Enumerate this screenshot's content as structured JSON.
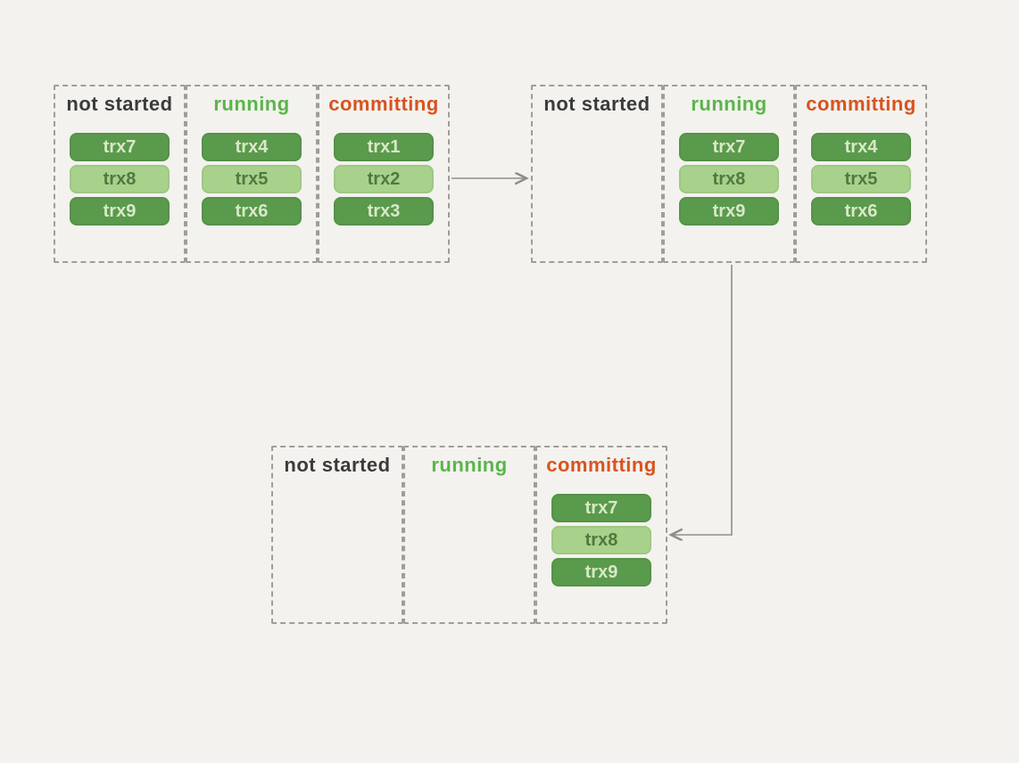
{
  "labels": {
    "not_started": "not started",
    "running": "running",
    "committing": "committing"
  },
  "stages": [
    {
      "id": "stage1",
      "columns": {
        "not_started": [
          "trx7",
          "trx8",
          "trx9"
        ],
        "running": [
          "trx4",
          "trx5",
          "trx6"
        ],
        "committing": [
          "trx1",
          "trx2",
          "trx3"
        ]
      }
    },
    {
      "id": "stage2",
      "columns": {
        "not_started": [],
        "running": [
          "trx7",
          "trx8",
          "trx9"
        ],
        "committing": [
          "trx4",
          "trx5",
          "trx6"
        ]
      }
    },
    {
      "id": "stage3",
      "columns": {
        "not_started": [],
        "running": [],
        "committing": [
          "trx7",
          "trx8",
          "trx9"
        ]
      }
    }
  ],
  "pill_shades": [
    "dark",
    "light",
    "dark"
  ]
}
